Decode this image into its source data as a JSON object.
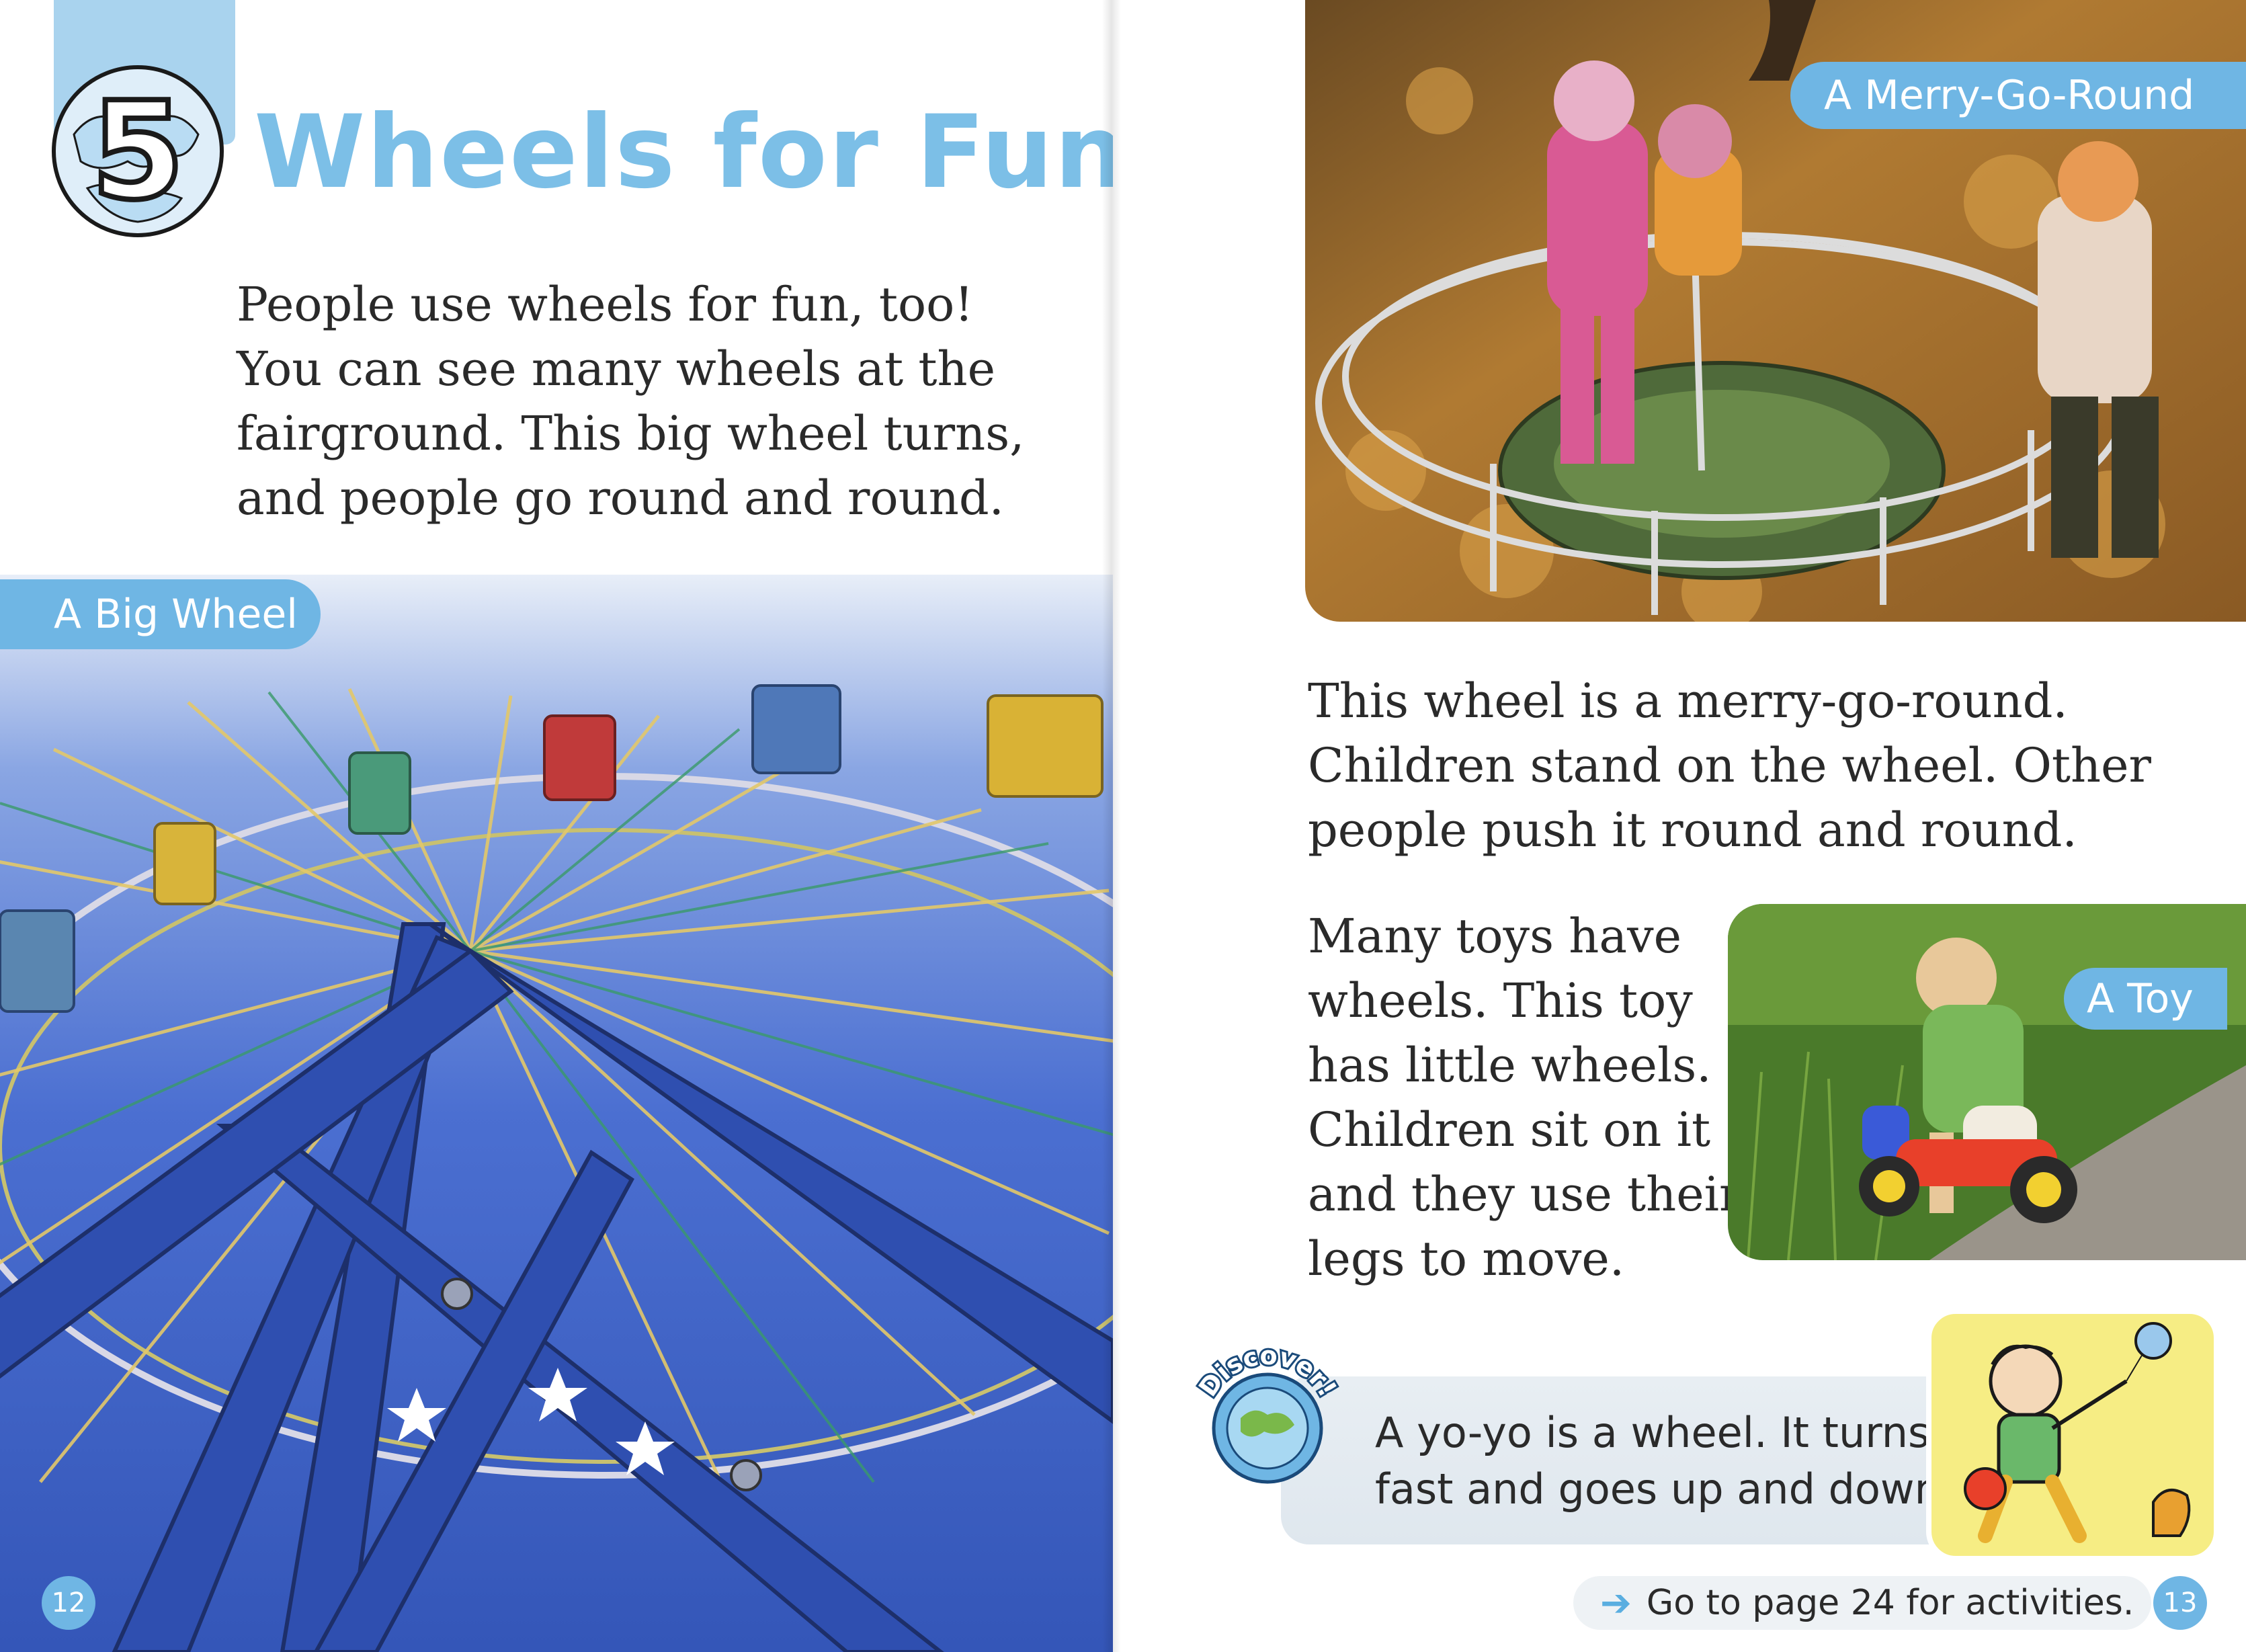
{
  "left_page": {
    "chapter_number": "5",
    "chapter_title": "Wheels for Fun",
    "intro_lines": [
      "People use wheels for fun, too!",
      "You can see many wheels at the",
      "fairground. This big wheel turns,",
      "and people go round and round."
    ],
    "photo_label": "A Big Wheel",
    "page_number": "12"
  },
  "right_page": {
    "photo_top_label": "A Merry-Go-Round",
    "merry_lines": [
      "This wheel is a merry-go-round.",
      "Children stand on the wheel. Other",
      "people push it round and round."
    ],
    "toy_lines": [
      "Many toys have",
      "wheels. This toy",
      "has little wheels.",
      "Children sit on it",
      "and they use their",
      "legs to move."
    ],
    "toy_label": "A Toy",
    "discover": {
      "badge_text": "Discover!",
      "lines": [
        "A yo-yo is a wheel. It turns",
        "fast and goes up and down."
      ]
    },
    "activities_text": "Go to page 24 for activities.",
    "page_number": "13"
  },
  "colors": {
    "accent_blue": "#6fb6e4",
    "title_blue": "#7cbfe7",
    "tab_blue": "#a9d3ee",
    "sky_blue": "#3f66c9"
  }
}
